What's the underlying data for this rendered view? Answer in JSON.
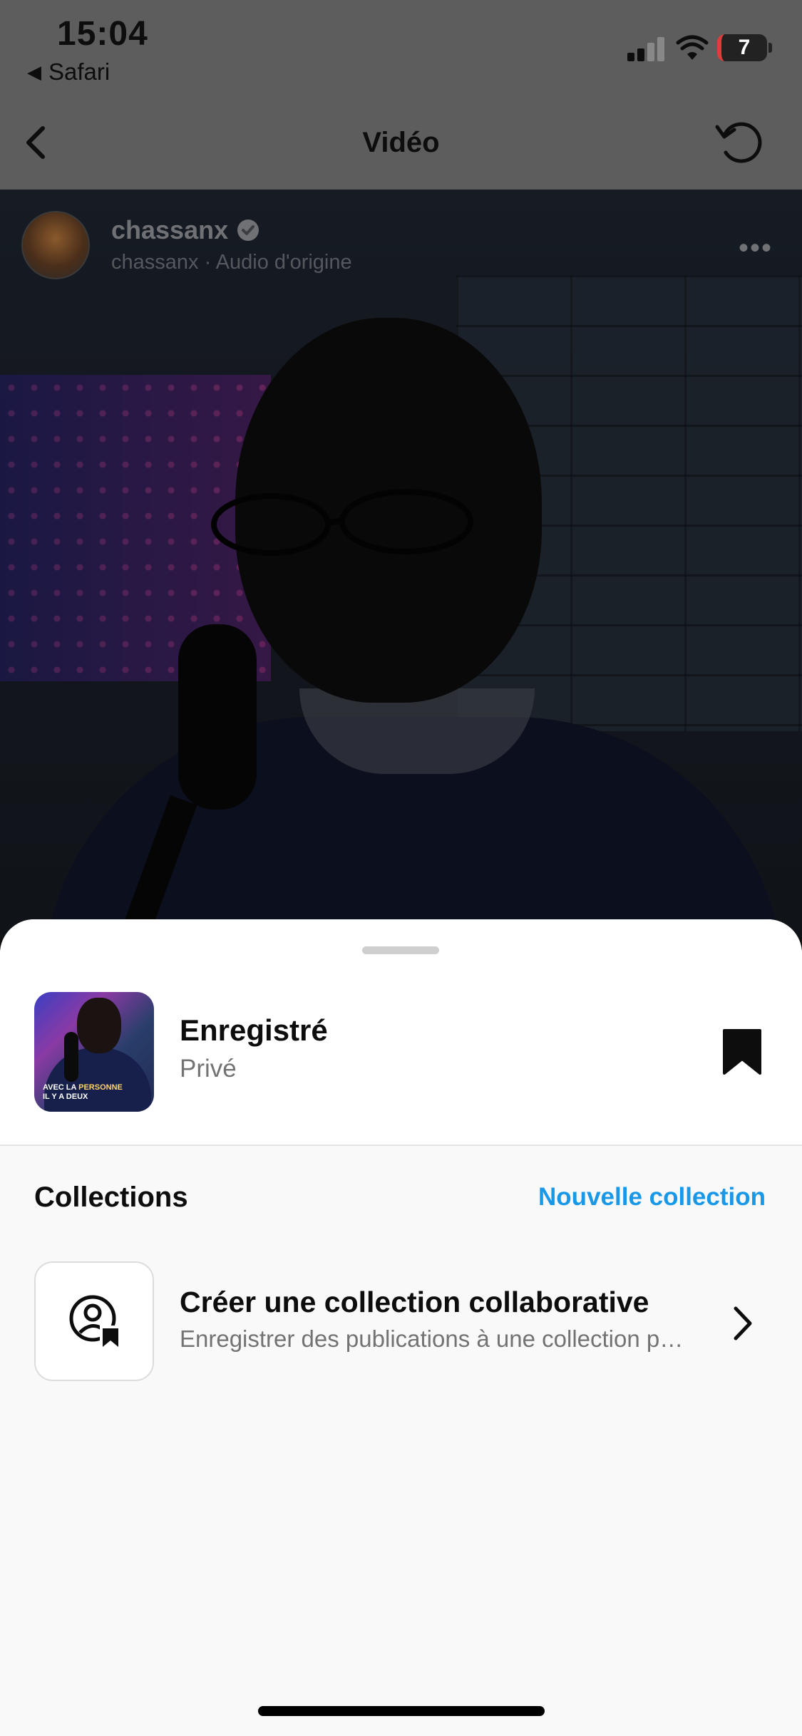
{
  "status_bar": {
    "time": "15:04",
    "back_app": "Safari",
    "back_app_icon": "triangle-left-icon",
    "battery": "7",
    "battery_level_fraction": 0.07,
    "colors": {
      "battery_low": "#e23b3b"
    }
  },
  "nav": {
    "title": "Vidéo",
    "back_icon": "chevron-left-icon",
    "refresh_icon": "refresh-icon"
  },
  "video": {
    "username": "chassanx",
    "verified_icon": "verified-badge-icon",
    "subtitle": "chassanx · Audio d'origine",
    "more_icon": "more-horizontal-icon",
    "more_text": "•••"
  },
  "sheet": {
    "saved": {
      "title": "Enregistré",
      "subtitle": "Privé",
      "thumb_caption_line1_a": "AVEC LA ",
      "thumb_caption_line1_b": "PERSONNE",
      "thumb_caption_line2": "IL Y A DEUX",
      "bookmark_icon": "bookmark-filled-icon"
    },
    "collections_label": "Collections",
    "new_collection": "Nouvelle collection",
    "collab": {
      "title": "Créer une collection collaborative",
      "subtitle": "Enregistrer des publications à une collection partagée",
      "icon": "collaborative-collection-icon",
      "chevron_icon": "chevron-right-icon"
    },
    "colors": {
      "link": "#1a98e8",
      "secondary_text": "#737373"
    }
  }
}
